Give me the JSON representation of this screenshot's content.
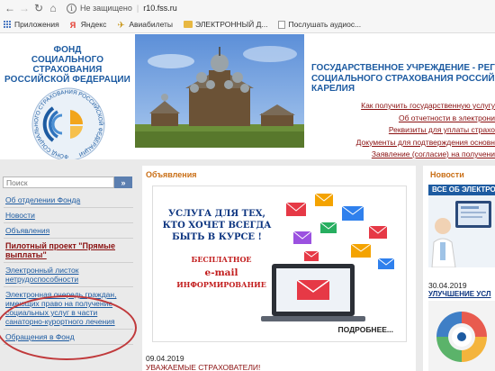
{
  "browser": {
    "security_status": "Не защищено",
    "url": "r10.fss.ru",
    "bookmarks": [
      {
        "label": "Приложения",
        "icon": "apps-icon"
      },
      {
        "label": "Яндекс",
        "icon": "yandex-icon"
      },
      {
        "label": "Авиабилеты",
        "icon": "plane-icon"
      },
      {
        "label": "ЭЛЕКТРОННЫЙ Д...",
        "icon": "folder-icon"
      },
      {
        "label": "Послушать аудиос...",
        "icon": "page-icon"
      }
    ]
  },
  "header": {
    "logo_lines": [
      "ФОНД",
      "СОЦИАЛЬНОГО СТРАХОВАНИЯ",
      "РОССИЙСКОЙ ФЕДЕРАЦИИ"
    ],
    "emblem_ring_text": "ФОНД СОЦИАЛЬНОГО СТРАХОВАНИЯ РОССИЙСКОЙ ФЕДЕРАЦИИ",
    "org_title_lines": [
      "ГОСУДАРСТВЕННОЕ УЧРЕЖДЕНИЕ - РЕГИОНА",
      "СОЦИАЛЬНОГО СТРАХОВАНИЯ РОССИЙ",
      "КАРЕЛИЯ"
    ],
    "links": [
      "Как получить государственную услугу",
      "Об отчетности в электрони",
      "Реквизиты для уплаты страхо",
      "Документы для подтверждения основн",
      "Заявление (согласие) на получени"
    ]
  },
  "sidebar": {
    "search_placeholder": "Поиск",
    "search_button": "»",
    "items": [
      {
        "label": "Об отделении Фонда",
        "bold": false
      },
      {
        "label": "Новости",
        "bold": false
      },
      {
        "label": "Объявления",
        "bold": false
      },
      {
        "label": "Пилотный проект \"Прямые выплаты\"",
        "bold": true
      },
      {
        "label": "Электронный листок нетрудоспособности",
        "bold": false
      },
      {
        "label": "Электронная очередь граждан, имеющих право на получение социальных услуг в части санаторно-курортного лечения",
        "bold": false
      },
      {
        "label": "Обращения в Фонд",
        "bold": false
      }
    ]
  },
  "center": {
    "section_title": "Объявления",
    "banner": {
      "headline": "УСЛУГА ДЛЯ ТЕХ, КТО ХОЧЕТ ВСЕГДА БЫТЬ В КУРСЕ !",
      "line1": "БЕСПЛАТНОЕ",
      "line2": "e-mail",
      "line3": "ИНФОРМИРОВАНИЕ",
      "more": "ПОДРОБНЕЕ..."
    },
    "news_date": "09.04.2019",
    "news_link": "УВАЖАЕМЫЕ СТРАХОВАТЕЛИ!"
  },
  "right": {
    "section_title": "Новости",
    "all_news": "ВСЕ ОБ ЭЛЕКТРОН",
    "date": "30.04.2019",
    "link": "УЛУЧШЕНИЕ УСЛ"
  },
  "colors": {
    "brand_blue": "#1d5ba1",
    "link_red": "#8a1010",
    "accent_orange": "#c96e15",
    "annotation_red": "#c0393b"
  }
}
